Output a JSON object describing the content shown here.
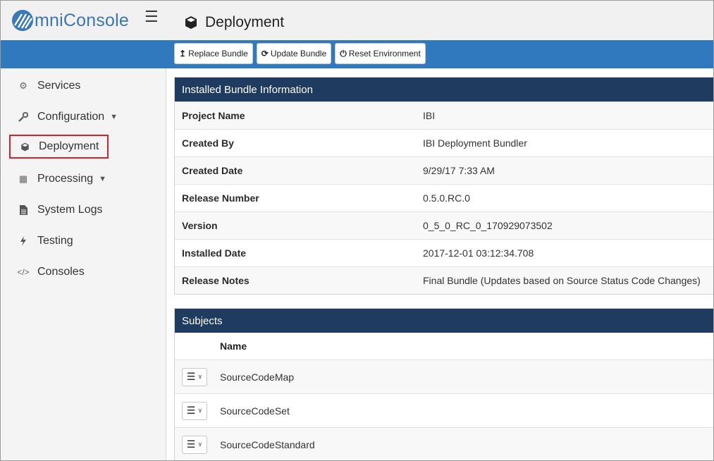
{
  "app": {
    "brand_text": "mniConsole"
  },
  "header": {
    "page_title": "Deployment"
  },
  "toolbar": {
    "replace_label": "Replace Bundle",
    "update_label": "Update Bundle",
    "reset_label": "Reset Environment"
  },
  "sidebar": {
    "items": [
      {
        "label": "Services",
        "icon": "gears-icon"
      },
      {
        "label": "Configuration",
        "icon": "wrench-icon",
        "has_caret": true
      },
      {
        "label": "Deployment",
        "icon": "cube-icon",
        "active": true
      },
      {
        "label": "Processing",
        "icon": "table-icon",
        "has_caret": true
      },
      {
        "label": "System Logs",
        "icon": "file-icon"
      },
      {
        "label": "Testing",
        "icon": "bolt-icon"
      },
      {
        "label": "Consoles",
        "icon": "code-icon"
      }
    ]
  },
  "bundle_info": {
    "title": "Installed Bundle Information",
    "rows": [
      {
        "label": "Project Name",
        "value": "IBI"
      },
      {
        "label": "Created By",
        "value": "IBI Deployment Bundler"
      },
      {
        "label": "Created Date",
        "value": "9/29/17 7:33 AM"
      },
      {
        "label": "Release Number",
        "value": "0.5.0.RC.0"
      },
      {
        "label": "Version",
        "value": "0_5_0_RC_0_170929073502"
      },
      {
        "label": "Installed Date",
        "value": "2017-12-01 03:12:34.708"
      },
      {
        "label": "Release Notes",
        "value": "Final Bundle (Updates based on Source Status Code Changes)"
      }
    ]
  },
  "subjects": {
    "title": "Subjects",
    "column_name": "Name",
    "rows": [
      {
        "name": "SourceCodeMap"
      },
      {
        "name": "SourceCodeSet"
      },
      {
        "name": "SourceCodeStandard"
      }
    ]
  },
  "colors": {
    "blue_bar": "#3179bf",
    "panel_header": "#1f3b60",
    "brand": "#3a76b4",
    "active_outline": "#d3242c"
  }
}
